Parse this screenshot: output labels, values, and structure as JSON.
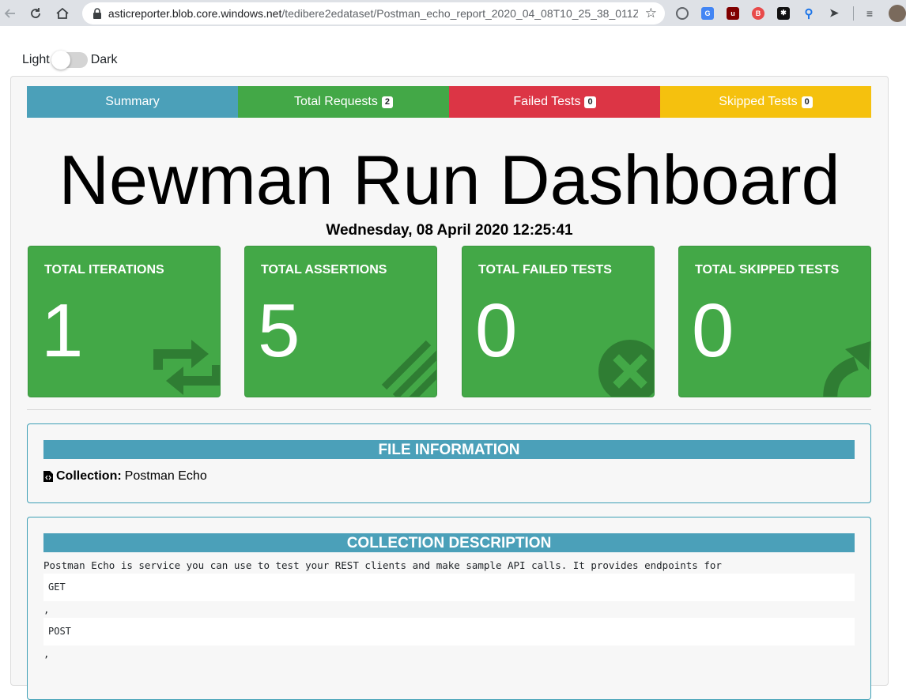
{
  "browser": {
    "url_host": "asticreporter.blob.core.windows.net",
    "url_path": "/tedibere2edataset/Postman_echo_report_2020_04_08T10_25_38_011Z...."
  },
  "theme_toggle": {
    "light_label": "Light",
    "dark_label": "Dark",
    "dark_enabled": false
  },
  "tabs": [
    {
      "label": "Summary",
      "badge": "",
      "color": "#4ba0b9"
    },
    {
      "label": "Total Requests",
      "badge": "2",
      "color": "#43a847"
    },
    {
      "label": "Failed Tests",
      "badge": "0",
      "color": "#dc3545"
    },
    {
      "label": "Skipped Tests",
      "badge": "0",
      "color": "#f5c10e"
    }
  ],
  "dashboard": {
    "title": "Newman Run Dashboard",
    "date": "Wednesday, 08 April 2020 12:25:41"
  },
  "stats": [
    {
      "label": "TOTAL ITERATIONS",
      "value": "1",
      "icon": "sync-icon"
    },
    {
      "label": "TOTAL ASSERTIONS",
      "value": "5",
      "icon": "tasks-icon"
    },
    {
      "label": "TOTAL FAILED TESTS",
      "value": "0",
      "icon": "times-circle-icon"
    },
    {
      "label": "TOTAL SKIPPED TESTS",
      "value": "0",
      "icon": "share-arrow-icon"
    }
  ],
  "file_info": {
    "header": "FILE INFORMATION",
    "collection_label": "Collection:",
    "collection_value": "Postman Echo"
  },
  "collection_description": {
    "header": "COLLECTION DESCRIPTION",
    "text": "Postman Echo is service you can use to test your REST clients and make sample API calls. It provides endpoints for",
    "code_items": [
      "GET",
      "POST"
    ],
    "separator": ","
  },
  "colors": {
    "success": "#43a847",
    "info": "#4ba0b9",
    "danger": "#dc3545",
    "warning": "#f5c10e",
    "card_bg": "#f7f7f7"
  }
}
